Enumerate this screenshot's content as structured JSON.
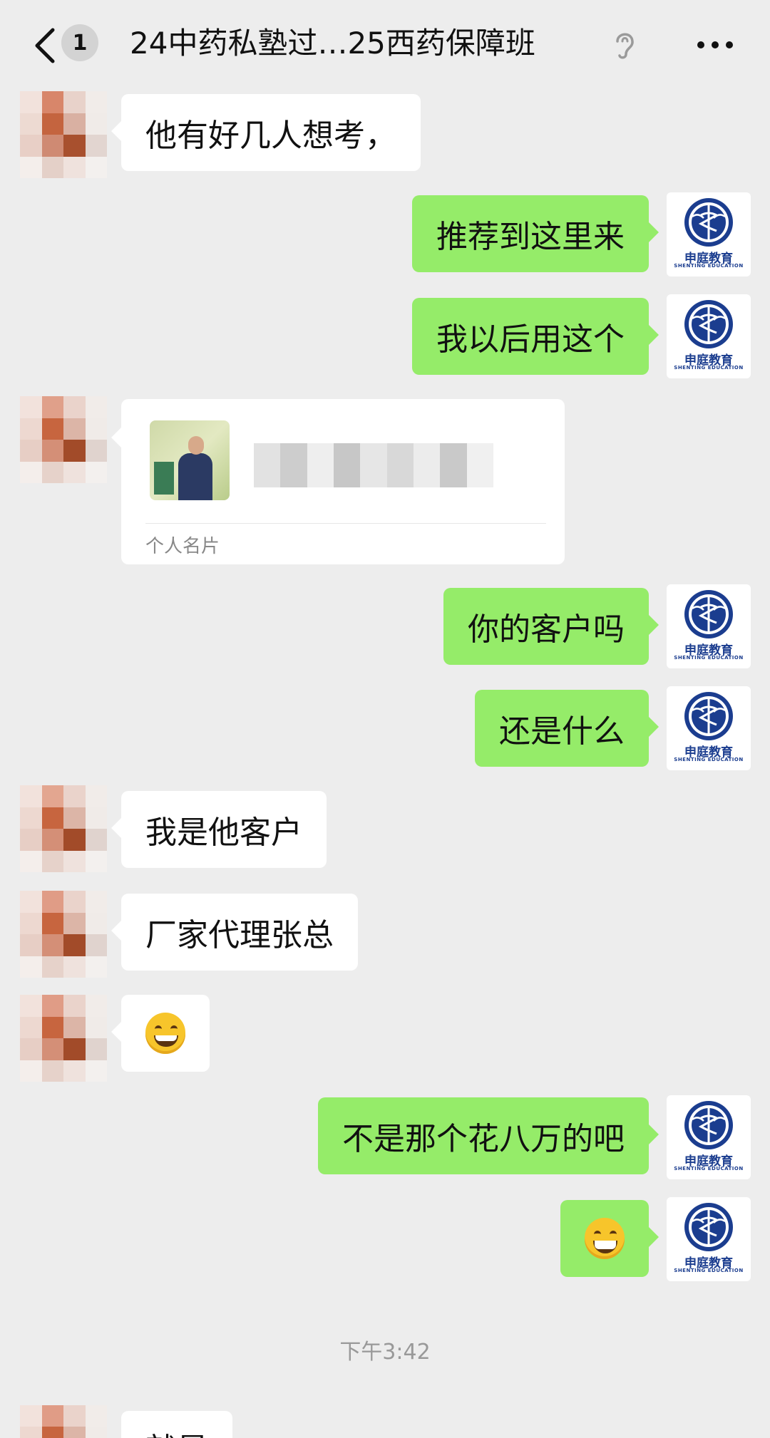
{
  "header": {
    "back_icon": "chevron-left-icon",
    "unread_count": "1",
    "title": "24中药私塾过…25西药保障班",
    "ear_icon": "ear-icon",
    "more_icon": "more-icon"
  },
  "brand": {
    "name": "申庭教育",
    "english": "SHENTING EDUCATION",
    "color": "#1b3d8f"
  },
  "colors": {
    "background": "#ededed",
    "incoming_bubble": "#ffffff",
    "outgoing_bubble": "#95ec69"
  },
  "messages": [
    {
      "side": "in",
      "text": "他有好几人想考，"
    },
    {
      "side": "out",
      "text": "推荐到这里来"
    },
    {
      "side": "out",
      "text": "我以后用这个"
    },
    {
      "side": "in",
      "type": "contact_card",
      "label": "个人名片"
    },
    {
      "side": "out",
      "text": "你的客户吗"
    },
    {
      "side": "out",
      "text": "还是什么"
    },
    {
      "side": "in",
      "text": "我是他客户"
    },
    {
      "side": "in",
      "text": "厂家代理张总"
    },
    {
      "side": "in",
      "type": "emoji",
      "emoji": "smile-emoji"
    },
    {
      "side": "out",
      "text": "不是那个花八万的吧"
    },
    {
      "side": "out",
      "type": "emoji",
      "emoji": "grin-emoji"
    }
  ],
  "timestamp": "下午3:42",
  "partial_last_message": "就是"
}
